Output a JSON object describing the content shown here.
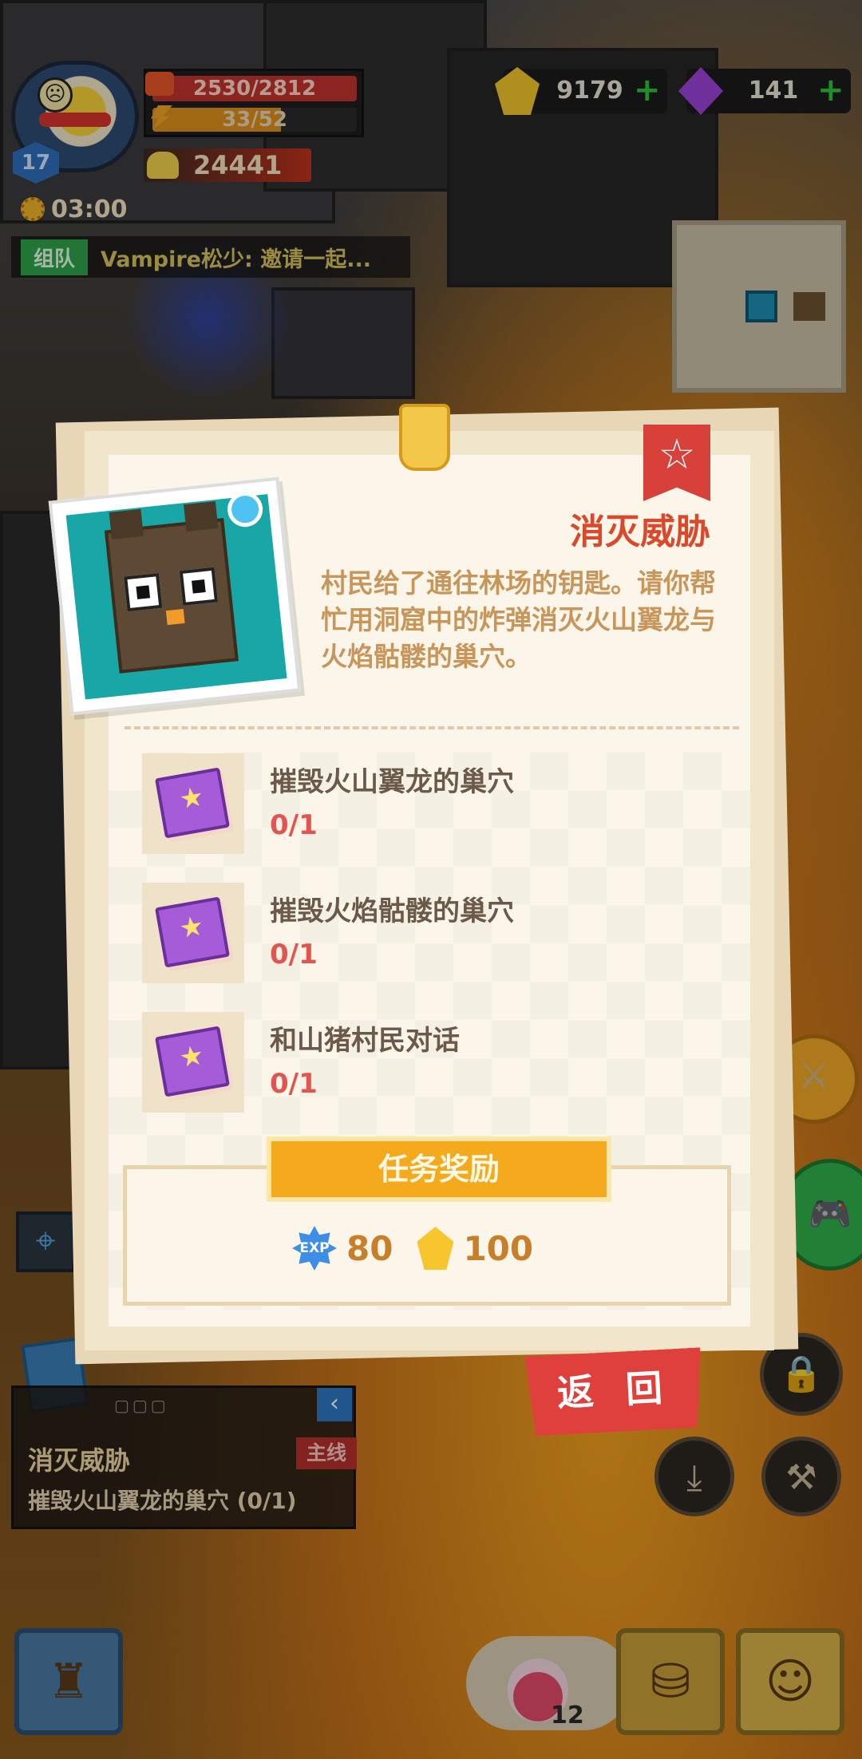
{
  "player": {
    "level": "17",
    "hp": "2530/2812",
    "exp": "33/52",
    "exp_fraction": 0.63,
    "power": "24441",
    "timer": "03:00"
  },
  "chat": {
    "tag": "组队",
    "message": "Vampire松少: 邀请一起..."
  },
  "currency": {
    "gold": "9179",
    "gems": "141"
  },
  "quest_card": {
    "title": "消灭威胁",
    "description": "村民给了通往林场的钥匙。请你帮忙用洞窟中的炸弹消灭火山翼龙与火焰骷髅的巢穴。",
    "objectives": [
      {
        "name": "摧毁火山翼龙的巢穴",
        "progress": "0/1"
      },
      {
        "name": "摧毁火焰骷髅的巢穴",
        "progress": "0/1"
      },
      {
        "name": "和山猪村民对话",
        "progress": "0/1"
      }
    ],
    "reward_title": "任务奖励",
    "rewards": {
      "exp_label": "EXP",
      "exp": "80",
      "gold": "100"
    },
    "back_label": "返 回"
  },
  "tracker": {
    "dots": "▢▢▢",
    "title": "消灭威胁",
    "tag": "主线",
    "objective": "摧毁火山翼龙的巢穴  (0/1)"
  },
  "inventory": {
    "potion_count": "12"
  },
  "icons": {
    "accent_red": "#e0403c",
    "accent_orange": "#f5a91d",
    "text_brown": "#6b5a4a"
  }
}
